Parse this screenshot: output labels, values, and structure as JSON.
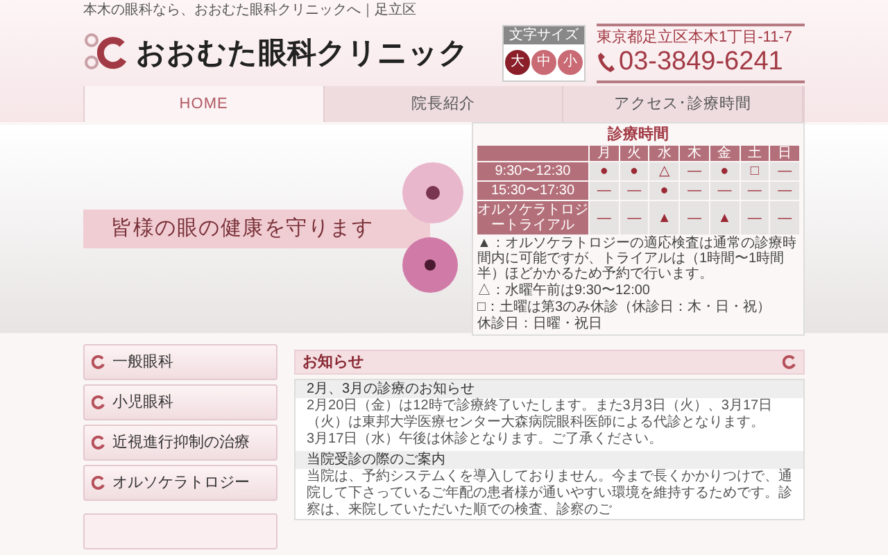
{
  "header": {
    "tagline": "本木の眼科なら、おおむた眼科クリニックへ｜足立区",
    "clinic_name": "おおむた眼科クリニック",
    "font_size": {
      "title": "文字サイズ",
      "options": [
        {
          "label": "大",
          "selected": true
        },
        {
          "label": "中",
          "selected": false
        },
        {
          "label": "小",
          "selected": false
        }
      ]
    },
    "address": "東京都足立区本木1丁目-11-7",
    "phone": "03-3849-6241"
  },
  "nav": [
    {
      "label": "HOME",
      "selected": true
    },
    {
      "label": "院長紹介",
      "selected": false
    },
    {
      "label": "アクセス･診療時間",
      "selected": false
    }
  ],
  "banner": {
    "slogan": "皆様の眼の健康を守ります"
  },
  "schedule": {
    "title": "診療時間",
    "days": [
      "月",
      "火",
      "水",
      "木",
      "金",
      "土",
      "日"
    ],
    "rows": [
      {
        "time": "9:30〜12:30",
        "marks": [
          "●",
          "●",
          "△",
          "―",
          "●",
          "□",
          "―"
        ]
      },
      {
        "time": "15:30〜17:30",
        "marks": [
          "―",
          "―",
          "●",
          "―",
          "―",
          "―",
          "―"
        ]
      },
      {
        "time": "オルソケラトロジートライアル",
        "marks": [
          "―",
          "―",
          "▲",
          "―",
          "▲",
          "―",
          "―"
        ]
      }
    ],
    "notes": [
      "▲：オルソケラトロジーの適応検査は通常の診療時間内に可能ですが、トライアルは（1時間〜1時間半）ほどかかるため予約で行います。",
      "△：水曜午前は9:30〜12:00",
      "□：土曜は第3のみ休診（休診日：木・日・祝）",
      "休診日：日曜・祝日"
    ]
  },
  "sidebar": {
    "items": [
      "一般眼科",
      "小児眼科",
      "近視進行抑制の治療",
      "オルソケラトロジー"
    ]
  },
  "news": {
    "title": "お知らせ",
    "entries": [
      {
        "title": "2月、3月の診療のお知らせ",
        "paragraphs": [
          "2月20日（金）は12時で診療終了いたします。また3月3日（火）、3月17日（火）は東邦大学医療センター大森病院眼科医師による代診となります。",
          "3月17日（水）午後は休診となります。ご了承ください。"
        ]
      },
      {
        "title": "当院受診の際のご案内",
        "paragraphs": [
          "当院は、予約システムくを導入しておりません。今まで長くかかりつけで、通院して下さっているご年配の患者様が通いやすい環境を維持するためです。診察は、来院していただいた順での検査、診察のご"
        ]
      }
    ]
  }
}
